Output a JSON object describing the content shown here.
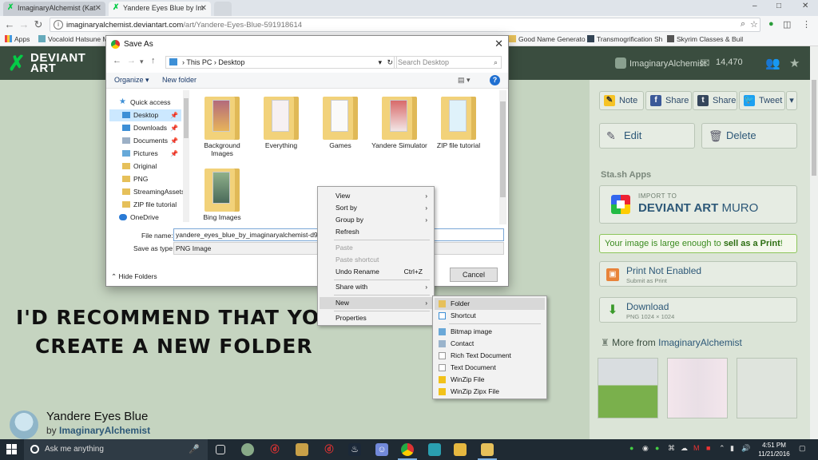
{
  "browser": {
    "tabs": [
      {
        "title": "ImaginaryAlchemist (Kat",
        "active": false
      },
      {
        "title": "Yandere Eyes Blue by Im",
        "active": true
      }
    ],
    "window_controls": [
      "–",
      "□",
      "✕"
    ],
    "url_host": "imaginaryalchemist.deviantart.com",
    "url_path": "/art/Yandere-Eyes-Blue-591918614",
    "bookmarks": [
      {
        "label": "Apps",
        "icon": "apps-grid-icon"
      },
      {
        "label": "Vocaloid Hatsune M",
        "icon": "vocaloid-icon"
      },
      {
        "label": "Good Name Generato",
        "icon": "folder-icon"
      },
      {
        "label": "Transmogrification Sh",
        "icon": "wow-icon"
      },
      {
        "label": "Skyrim Classes & Buil",
        "icon": "skyrim-icon"
      }
    ]
  },
  "da": {
    "logo_line1": "DEVIANT",
    "logo_line2": "ART",
    "username": "ImaginaryAlchemist",
    "notes_count": "14,470",
    "share_buttons": [
      {
        "label": "Note",
        "icon": "note-icon",
        "color": "#f6c325"
      },
      {
        "label": "Share",
        "icon": "facebook-icon",
        "color": "#3b5998"
      },
      {
        "label": "Share",
        "icon": "tumblr-icon",
        "color": "#35465c"
      },
      {
        "label": "Tweet",
        "icon": "twitter-icon",
        "color": "#1da1f2"
      }
    ],
    "edit_label": "Edit",
    "delete_label": "Delete",
    "stash_title": "Sta.sh Apps",
    "muro_import": "IMPORT TO",
    "muro_brand": "DEVIANT ART",
    "muro_name": "MURO",
    "sell_prefix": "Your image is large enough to ",
    "sell_bold": "sell as a Print",
    "sell_suffix": "!",
    "print_title": "Print Not Enabled",
    "print_sub": "Submit as Print",
    "download_title": "Download",
    "download_sub": "PNG 1024 × 1024",
    "more_from_prefix": "More from ",
    "more_from_user": "ImaginaryAlchemist",
    "deviation_title": "Yandere Eyes Blue",
    "deviation_by": "by",
    "deviation_author": "ImaginaryAlchemist"
  },
  "annotation": {
    "line1": "I'D RECOMMEND THAT YOU",
    "line2": "CREATE A NEW FOLDER"
  },
  "dialog": {
    "title": "Save As",
    "path_this_pc": "This PC",
    "path_sep": "›",
    "path_desktop": "Desktop",
    "search_placeholder": "Search Desktop",
    "organize": "Organize ▾",
    "new_folder": "New folder",
    "tree": [
      {
        "label": "Quick access",
        "icon": "star-icon"
      },
      {
        "label": "Desktop",
        "icon": "desktop-icon",
        "selected": true
      },
      {
        "label": "Downloads",
        "icon": "download-icon"
      },
      {
        "label": "Documents",
        "icon": "document-icon"
      },
      {
        "label": "Pictures",
        "icon": "picture-icon"
      },
      {
        "label": "Original",
        "icon": "folder-icon"
      },
      {
        "label": "PNG",
        "icon": "folder-icon"
      },
      {
        "label": "StreamingAssets",
        "icon": "folder-icon"
      },
      {
        "label": "ZIP file tutorial",
        "icon": "folder-icon"
      },
      {
        "label": "OneDrive",
        "icon": "onedrive-icon"
      }
    ],
    "files": [
      {
        "label": "Background Images"
      },
      {
        "label": "Everything"
      },
      {
        "label": "Games"
      },
      {
        "label": "Yandere Simulator"
      },
      {
        "label": "ZIP file tutorial"
      },
      {
        "label": "Bing Images"
      }
    ],
    "file_name_label": "File name:",
    "file_name_value": "yandere_eyes_blue_by_imaginaryalchemist-d9sevb",
    "save_type_label": "Save as type:",
    "save_type_value": "PNG Image",
    "hide_folders": "Hide Folders",
    "cancel": "Cancel"
  },
  "context_menu": {
    "items": [
      {
        "label": "View",
        "submenu": true
      },
      {
        "label": "Sort by",
        "submenu": true
      },
      {
        "label": "Group by",
        "submenu": true
      },
      {
        "label": "Refresh"
      },
      {
        "label": "Paste",
        "disabled": true
      },
      {
        "label": "Paste shortcut",
        "disabled": true
      },
      {
        "label": "Undo Rename",
        "shortcut": "Ctrl+Z"
      },
      {
        "label": "Share with",
        "submenu": true
      },
      {
        "label": "New",
        "submenu": true,
        "highlighted": true
      },
      {
        "label": "Properties"
      }
    ]
  },
  "new_submenu": {
    "items": [
      {
        "label": "Folder",
        "icon": "folder-icon",
        "highlighted": true
      },
      {
        "label": "Shortcut",
        "icon": "shortcut-icon"
      },
      {
        "label": "Bitmap image",
        "icon": "bitmap-icon"
      },
      {
        "label": "Contact",
        "icon": "contact-icon"
      },
      {
        "label": "Rich Text Document",
        "icon": "rtf-icon"
      },
      {
        "label": "Text Document",
        "icon": "text-document-icon"
      },
      {
        "label": "WinZip File",
        "icon": "winzip-icon"
      },
      {
        "label": "WinZip Zipx File",
        "icon": "winzip-icon"
      }
    ]
  },
  "taskbar": {
    "search_placeholder": "Ask me anything",
    "time": "4:51 PM",
    "date": "11/21/2016"
  }
}
